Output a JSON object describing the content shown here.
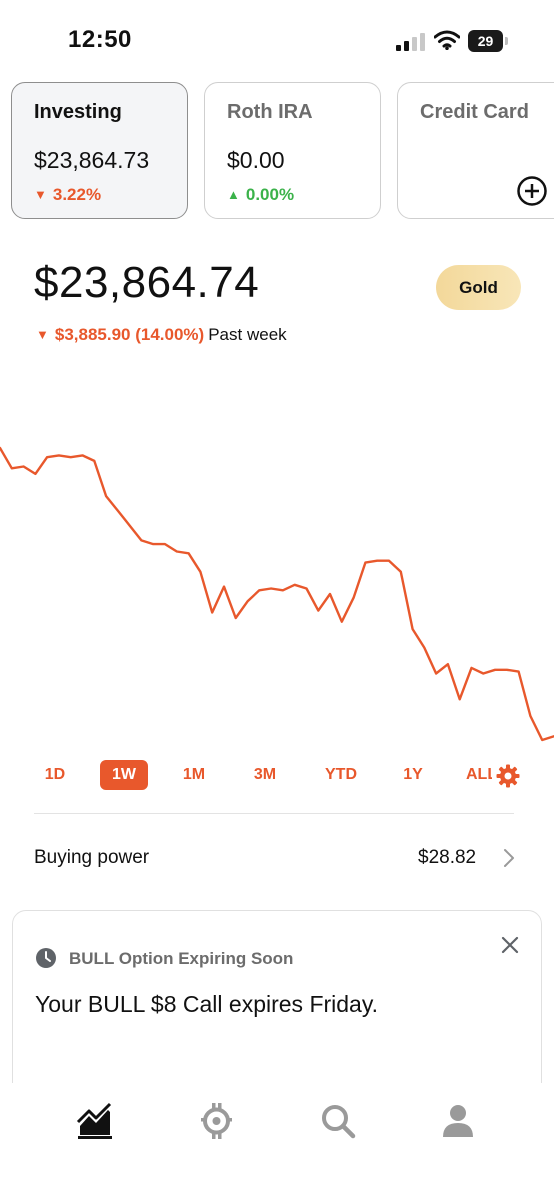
{
  "status_bar": {
    "time": "12:50",
    "battery": "29"
  },
  "accounts": [
    {
      "title": "Investing",
      "value": "$23,864.73",
      "change": "3.22%",
      "direction": "down",
      "active": true
    },
    {
      "title": "Roth IRA",
      "value": "$0.00",
      "change": "0.00%",
      "direction": "up",
      "active": false
    },
    {
      "title": "Credit Card",
      "icon": "add-circle-icon",
      "active": false
    }
  ],
  "portfolio": {
    "value": "$23,864.74",
    "badge": "Gold",
    "change": "$3,885.90 (14.00%)",
    "period": "Past week",
    "direction": "down"
  },
  "chart_data": {
    "type": "line",
    "series": [
      {
        "values": [
          100,
          98.9,
          99.0,
          98.6,
          99.5,
          99.6,
          99.5,
          99.6,
          99.3,
          97.4,
          96.6,
          95.8,
          95.0,
          94.8,
          94.8,
          94.4,
          94.3,
          93.3,
          91.1,
          92.5,
          90.8,
          91.7,
          92.3,
          92.4,
          92.3,
          92.6,
          92.4,
          91.2,
          92.1,
          90.6,
          91.9,
          93.8,
          93.9,
          93.9,
          93.3,
          90.2,
          89.2,
          87.8,
          88.3,
          86.4,
          88.1,
          87.8,
          88.0,
          88.0,
          87.9,
          85.5,
          84.2,
          84.4
        ]
      }
    ],
    "color": "#e8582c",
    "grid": false,
    "range": "1W"
  },
  "range_tabs": {
    "items": [
      "1D",
      "1W",
      "1M",
      "3M",
      "YTD",
      "1Y"
    ],
    "active": "1W",
    "all_label": "ALL"
  },
  "buying_power": {
    "label": "Buying power",
    "value": "$28.82"
  },
  "notice": {
    "title": "BULL Option Expiring Soon",
    "body": "Your BULL $8 Call expires Friday."
  },
  "nav": [
    "chart-icon",
    "crypto-icon",
    "search-icon",
    "account-icon"
  ],
  "colors": {
    "accent": "#e8582c",
    "positive": "#3bb24a",
    "gold": "#f3d89a"
  }
}
